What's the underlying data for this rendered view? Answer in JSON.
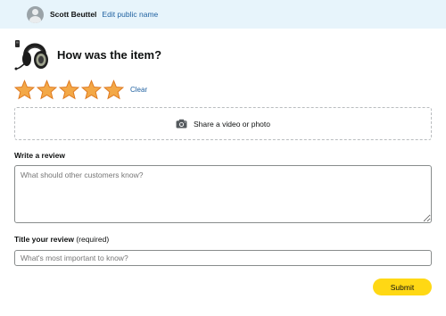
{
  "header": {
    "user_name": "Scott Beuttel",
    "edit_link": "Edit public name",
    "background_color": "#e7f4fb",
    "link_color": "#2162a1"
  },
  "product": {
    "image_icon": "headset-icon",
    "question": "How was the item?"
  },
  "rating": {
    "value": 5,
    "max": 5,
    "star_color": "#f3a847",
    "clear_label": "Clear"
  },
  "media_upload": {
    "icon": "camera-icon",
    "label": "Share a video or photo"
  },
  "review": {
    "label": "Write a review",
    "placeholder": "What should other customers know?",
    "value": ""
  },
  "title": {
    "label": "Title your review",
    "required_note": "(required)",
    "placeholder": "What's most important to know?",
    "value": ""
  },
  "actions": {
    "submit_label": "Submit",
    "submit_color": "#ffd814"
  }
}
